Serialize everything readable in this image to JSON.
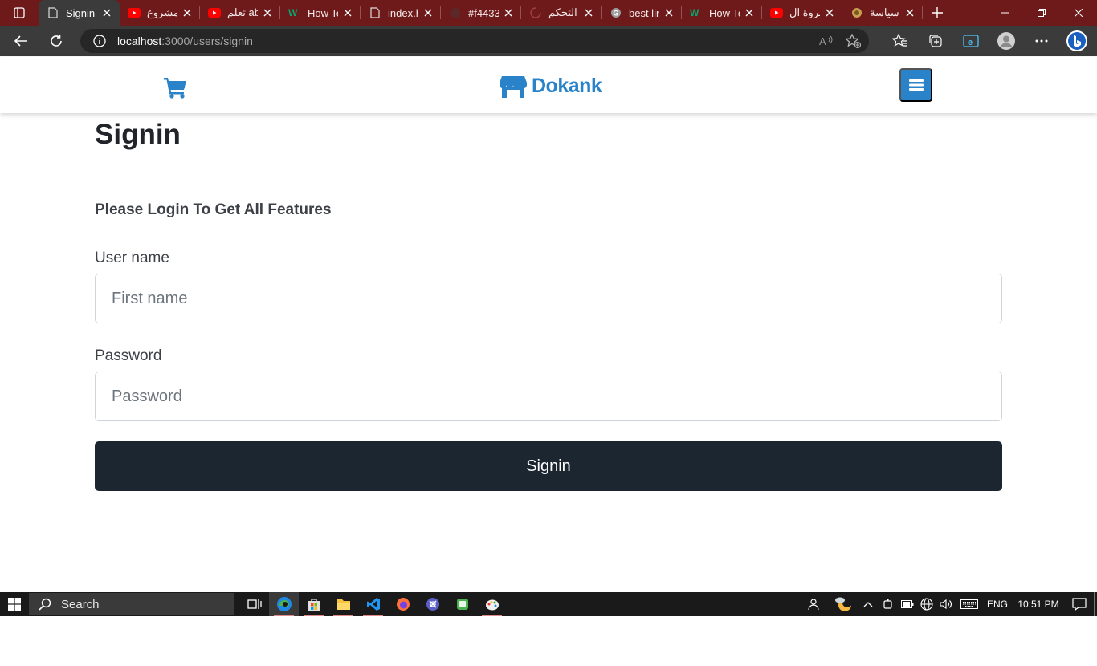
{
  "browser": {
    "tabs": [
      {
        "title": "Signin",
        "icon": "page-icon",
        "active": true
      },
      {
        "title": "مشروع",
        "icon": "youtube-icon"
      },
      {
        "title": "تعلم ab",
        "icon": "youtube-icon"
      },
      {
        "title": "How To",
        "icon": "w3schools-icon"
      },
      {
        "title": "index.h",
        "icon": "page-icon"
      },
      {
        "title": "#f4433",
        "icon": "color-icon"
      },
      {
        "title": "التحكم",
        "icon": "loading-icon"
      },
      {
        "title": "best lin",
        "icon": "google-icon"
      },
      {
        "title": "How To",
        "icon": "w3schools-icon"
      },
      {
        "title": "مروة ال",
        "icon": "youtube-icon"
      },
      {
        "title": "سياسة",
        "icon": "site-icon"
      }
    ],
    "url_host": "localhost",
    "url_path": ":3000/users/signin"
  },
  "site": {
    "brand": "Dokank",
    "colors": {
      "brand": "#2a83c9",
      "button_dark": "#1c2630"
    }
  },
  "form": {
    "title": "Signin",
    "subtitle": "Please Login To Get All Features",
    "username_label": "User name",
    "username_placeholder": "First name",
    "password_label": "Password",
    "password_placeholder": "Password",
    "submit_label": "Signin"
  },
  "taskbar": {
    "search_placeholder": "Search",
    "language": "ENG",
    "time": "10:51 PM"
  }
}
